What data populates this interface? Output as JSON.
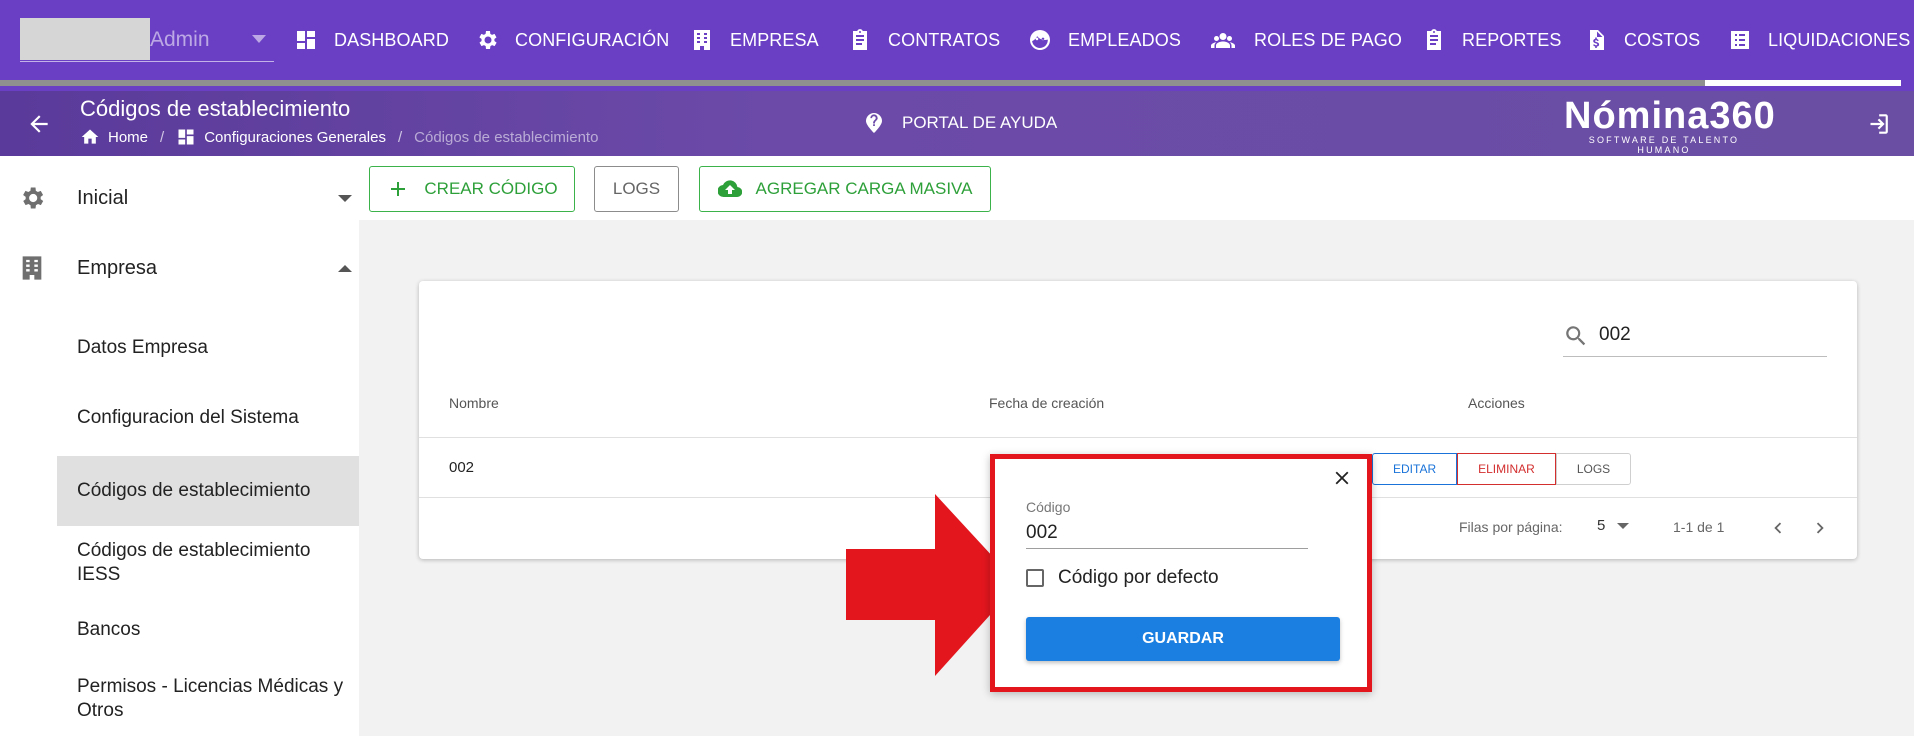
{
  "user": {
    "name": "Admin"
  },
  "nav": [
    {
      "label": "DASHBOARD",
      "icon": "dashboard-icon"
    },
    {
      "label": "CONFIGURACIÓN",
      "icon": "gear-icon"
    },
    {
      "label": "EMPRESA",
      "icon": "building-icon"
    },
    {
      "label": "CONTRATOS",
      "icon": "clipboard-icon"
    },
    {
      "label": "EMPLEADOS",
      "icon": "face-icon"
    },
    {
      "label": "ROLES DE PAGO",
      "icon": "people-icon"
    },
    {
      "label": "REPORTES",
      "icon": "clipboard-icon"
    },
    {
      "label": "COSTOS",
      "icon": "document-dollar-icon"
    },
    {
      "label": "LIQUIDACIONES",
      "icon": "list-icon"
    }
  ],
  "header": {
    "title": "Códigos de establecimiento",
    "breadcrumb": {
      "home": "Home",
      "section": "Configuraciones Generales",
      "current": "Códigos de establecimiento"
    },
    "help": "PORTAL DE AYUDA",
    "brand_name": "Nómina360",
    "brand_tagline": "SOFTWARE DE TALENTO HUMANO"
  },
  "sidebar": {
    "groups": [
      {
        "label": "Inicial",
        "icon": "gear-icon",
        "expanded": false
      },
      {
        "label": "Empresa",
        "icon": "building-icon",
        "expanded": true
      }
    ],
    "items": [
      {
        "label": "Datos Empresa"
      },
      {
        "label": "Configuracion del Sistema"
      },
      {
        "label": "Códigos de establecimiento",
        "active": true
      },
      {
        "label": "Códigos de establecimiento IESS"
      },
      {
        "label": "Bancos"
      },
      {
        "label": "Permisos - Licencias Médicas y Otros"
      }
    ]
  },
  "actions": {
    "create": "CREAR CÓDIGO",
    "logs": "LOGS",
    "bulk": "AGREGAR CARGA MASIVA"
  },
  "table": {
    "search_value": "002",
    "columns": [
      "Nombre",
      "Fecha de creación",
      "Acciones"
    ],
    "rows": [
      {
        "nombre": "002",
        "fecha": ""
      }
    ],
    "row_actions": {
      "edit": "EDITAR",
      "delete": "ELIMINAR",
      "logs": "LOGS"
    },
    "pagination": {
      "rows_per_page_label": "Filas por página:",
      "rows_per_page": "5",
      "range": "1-1 de 1"
    }
  },
  "popover": {
    "field_label": "Código",
    "field_value": "002",
    "checkbox_label": "Código por defecto",
    "checkbox_checked": false,
    "save": "GUARDAR"
  },
  "colors": {
    "nav_bg": "#6a3fc4",
    "accent_green": "#2ea03a",
    "primary_blue": "#1a7fe0",
    "highlight_red": "#e3161e"
  }
}
